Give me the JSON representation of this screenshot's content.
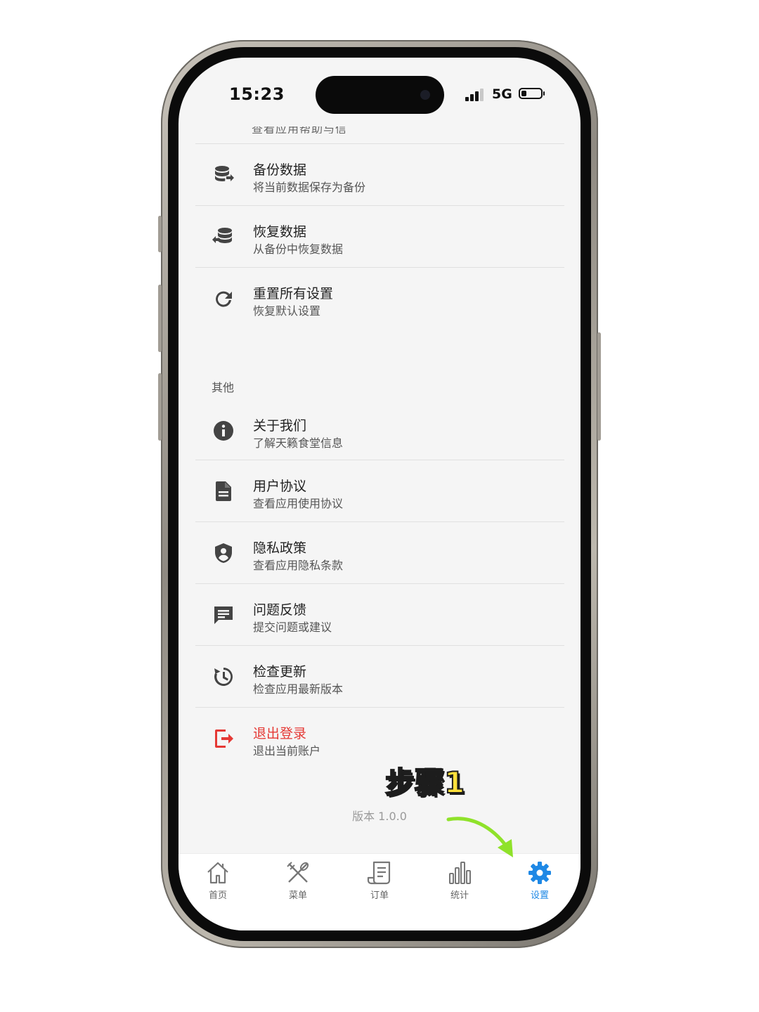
{
  "status_bar": {
    "time": "15:23",
    "network": "5G",
    "battery_level": 0.25
  },
  "scroll_peek_text": "查看应用帮助与信息",
  "sections": {
    "data_items": [
      {
        "id": "backup",
        "icon": "database-upload-icon",
        "title": "备份数据",
        "desc": "将当前数据保存为备份"
      },
      {
        "id": "restore",
        "icon": "database-restore-icon",
        "title": "恢复数据",
        "desc": "从备份中恢复数据"
      },
      {
        "id": "reset",
        "icon": "refresh-icon",
        "title": "重置所有设置",
        "desc": "恢复默认设置"
      }
    ],
    "other_title": "其他",
    "other_items": [
      {
        "id": "about",
        "icon": "info-icon",
        "title": "关于我们",
        "desc": "了解天籁食堂信息"
      },
      {
        "id": "agreement",
        "icon": "document-icon",
        "title": "用户协议",
        "desc": "查看应用使用协议"
      },
      {
        "id": "privacy",
        "icon": "shield-icon",
        "title": "隐私政策",
        "desc": "查看应用隐私条款"
      },
      {
        "id": "feedback",
        "icon": "message-icon",
        "title": "问题反馈",
        "desc": "提交问题或建议"
      },
      {
        "id": "update",
        "icon": "update-icon",
        "title": "检查更新",
        "desc": "检查应用最新版本"
      },
      {
        "id": "logout",
        "icon": "logout-icon",
        "title": "退出登录",
        "desc": "退出当前账户"
      }
    ]
  },
  "version": "版本 1.0.0",
  "tabs": [
    {
      "id": "home",
      "label": "首页",
      "icon": "home-icon",
      "active": false
    },
    {
      "id": "menu",
      "label": "菜单",
      "icon": "utensils-icon",
      "active": false
    },
    {
      "id": "orders",
      "label": "订单",
      "icon": "receipt-icon",
      "active": false
    },
    {
      "id": "stats",
      "label": "统计",
      "icon": "bar-chart-icon",
      "active": false
    },
    {
      "id": "settings",
      "label": "设置",
      "icon": "gear-icon",
      "active": true
    }
  ],
  "annotation": {
    "label": "步骤1",
    "color": "#ffe03b",
    "arrow_color": "#8fe22a"
  },
  "colors": {
    "accent": "#1e88e5",
    "danger": "#e53935"
  }
}
